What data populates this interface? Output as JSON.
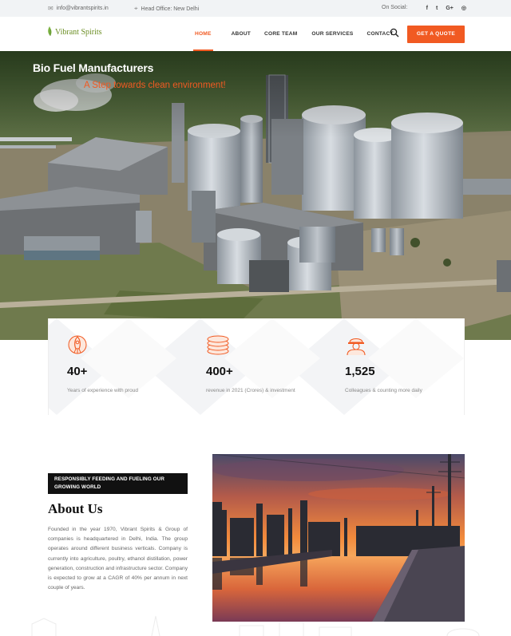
{
  "topbar": {
    "email": "info@vibrantspirits.in",
    "head_office": "Head Office: New Delhi",
    "social_label": "On Social:",
    "social_icons": [
      "facebook-icon",
      "twitter-icon",
      "google-plus-icon",
      "instagram-icon"
    ],
    "social_glyphs": [
      "f",
      "t",
      "G+",
      "◎"
    ]
  },
  "header": {
    "logo_text": "Vibrant Spirits",
    "nav": [
      {
        "label": "HOME",
        "active": true
      },
      {
        "label": "ABOUT",
        "active": false
      },
      {
        "label": "CORE TEAM",
        "active": false
      },
      {
        "label": "OUR SERVICES",
        "active": false
      },
      {
        "label": "CONTACT",
        "active": false
      }
    ],
    "cta": "GET A QUOTE"
  },
  "hero": {
    "title": "Bio Fuel Manufacturers",
    "subtitle": "A Step towards clean environment!"
  },
  "stats": [
    {
      "icon": "rocket-icon",
      "value": "40+",
      "label": "Years of experience with proud"
    },
    {
      "icon": "coins-icon",
      "value": "400+",
      "label": "revenue in 2021 (Crores) & investment"
    },
    {
      "icon": "worker-icon",
      "value": "1,525",
      "label": "Colleagues & counting more daily"
    }
  ],
  "about": {
    "badge": "RESPONSIBLY FEEDING AND FUELING OUR GROWING WORLD",
    "title": "About Us",
    "body": "Founded in the year 1970, Vibrant Spirits & Group of companies is headquartered in Delhi, India. The group operates around different business verticals. Company is currently into agriculture, poultry, ethanol distillation, power generation, construction and infrastructure sector. Company is  expected to grow at a CAGR of 40%  per annum in next couple of years."
  },
  "colors": {
    "accent": "#f15a22",
    "topbar_bg": "#f1f3f5",
    "badge_bg": "#111111"
  }
}
